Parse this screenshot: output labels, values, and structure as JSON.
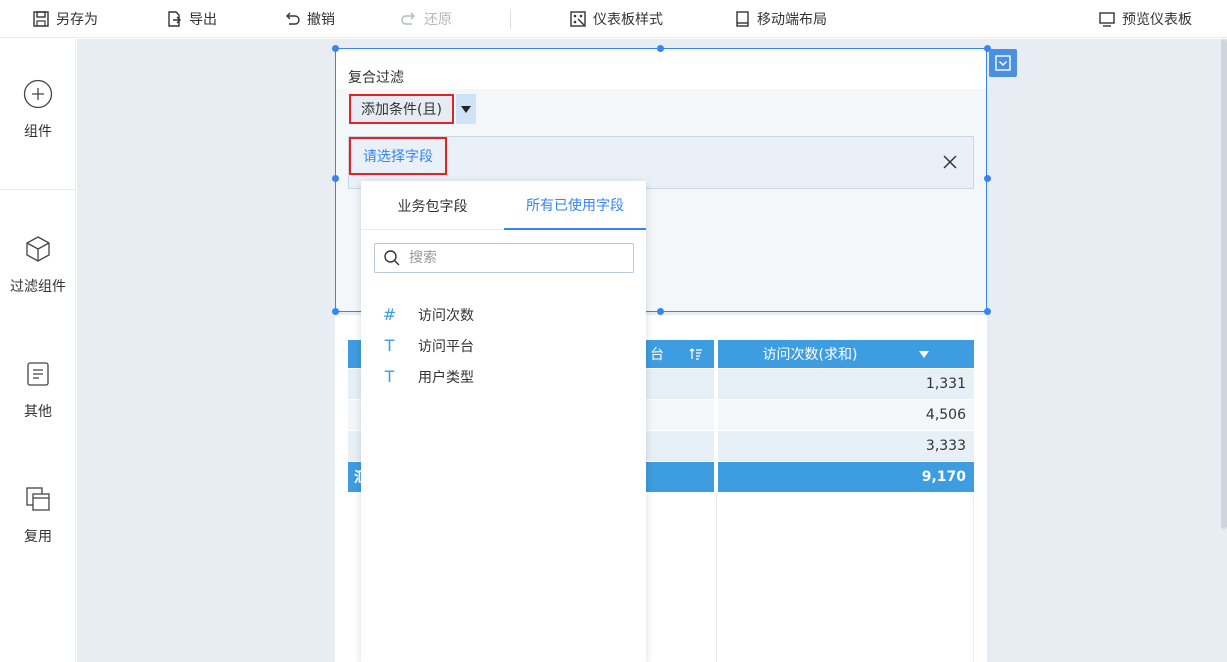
{
  "toolbar": {
    "save_as": "另存为",
    "export": "导出",
    "undo": "撤销",
    "redo": "还原",
    "dashboard_style": "仪表板样式",
    "mobile_layout": "移动端布局",
    "preview": "预览仪表板"
  },
  "sidebar": {
    "items": [
      {
        "label": "组件",
        "icon": "plus-circle-icon"
      },
      {
        "label": "过滤组件",
        "icon": "cube-icon"
      },
      {
        "label": "其他",
        "icon": "document-icon"
      },
      {
        "label": "复用",
        "icon": "copy-icon"
      }
    ]
  },
  "filter_widget": {
    "title": "复合过滤",
    "add_condition": "添加条件(且)",
    "field_placeholder": "请选择字段"
  },
  "table": {
    "header_partial": "台",
    "header_value": "访问次数(求和)",
    "rows": [
      "1,331",
      "4,506",
      "3,333"
    ],
    "total": "9,170",
    "total_partial": "汇"
  },
  "dropdown": {
    "tabs": [
      "业务包字段",
      "所有已使用字段"
    ],
    "active_tab": 1,
    "search_placeholder": "搜索",
    "fields": [
      {
        "type": "#",
        "name": "访问次数"
      },
      {
        "type": "T",
        "name": "访问平台"
      },
      {
        "type": "T",
        "name": "用户类型"
      }
    ]
  },
  "colors": {
    "accent": "#3685f2",
    "table_header": "#3e9de0",
    "highlight_box": "#e02424"
  }
}
